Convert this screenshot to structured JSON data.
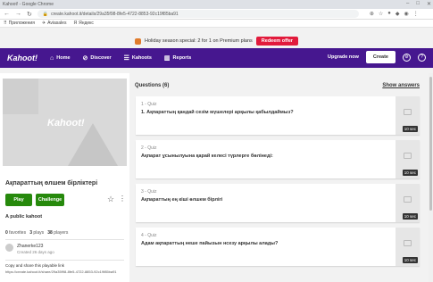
{
  "browser": {
    "title": "Kahoot! - Google Chrome",
    "url": "create.kahoot.it/details/29a35f98-8fe5-4722-8853-92c19f85ba91",
    "bookmarks": [
      "Приложения",
      "Aviasales",
      "Яндекс"
    ]
  },
  "promo": {
    "text": "Holiday season special: 2 for 1 on Premium plans",
    "button": "Redeem offer"
  },
  "nav": {
    "logo": "Kahoot!",
    "items": [
      "Home",
      "Discover",
      "Kahoots",
      "Reports"
    ],
    "upgrade": "Upgrade now",
    "create": "Create"
  },
  "kahoot": {
    "cover_logo": "Kahoot!",
    "title": "Ақпараттың өлшем бірліктері",
    "play": "Play",
    "challenge": "Challenge",
    "visibility": "A public kahoot",
    "favorites": "0",
    "favorites_label": "favorites",
    "plays": "3",
    "plays_label": "plays",
    "players": "38",
    "players_label": "players",
    "user": "Zhanerke123",
    "created": "Created 26 days ago",
    "copy_label": "Copy and share this playable link",
    "link": "https://create.kahoot.it/share/29a35f98-8fe5-4722-8853-92c19f85ba91"
  },
  "questions": {
    "header": "Questions (6)",
    "show_answers": "Show answers",
    "items": [
      {
        "type": "1 - Quiz",
        "text": "1. Ақпараттың қандай сезім мүшелері арқылы қабылдаймыз?",
        "time": "10 sec"
      },
      {
        "type": "2 - Quiz",
        "text": "Ақпарат ұсынылуына қарай келесі түрлерге бөлінеді:",
        "time": "10 sec"
      },
      {
        "type": "3 - Quiz",
        "text": "Ақпараттың ең кіші өлшем бірлігі",
        "time": "10 sec"
      },
      {
        "type": "4 - Quiz",
        "text": "Адам ақпараттың неше пайызын нсезу арқылы алады?",
        "time": "10 sec"
      }
    ]
  }
}
